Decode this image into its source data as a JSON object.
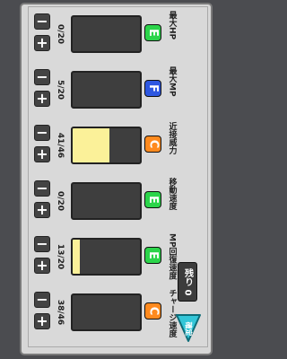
{
  "points": {
    "label": "残り 0"
  },
  "confirm": {
    "label": "確定"
  },
  "colors": {
    "E": "#2bd44a",
    "F": "#2d57e0",
    "C": "#ff8a1e",
    "bar_fill": "#fbf199"
  },
  "stats": [
    {
      "name": "最大HP",
      "count": "0/20",
      "fill": 0.0,
      "grade": "E"
    },
    {
      "name": "最大MP",
      "count": "5/20",
      "fill": 0.0,
      "grade": "F"
    },
    {
      "name": "近接威力",
      "count": "41/46",
      "fill": 0.55,
      "grade": "C"
    },
    {
      "name": "移動速度",
      "count": "0/20",
      "fill": 0.0,
      "grade": "E"
    },
    {
      "name": "MP回復速度",
      "count": "13/20",
      "fill": 0.1,
      "grade": "E"
    },
    {
      "name": "チャージ速度",
      "count": "38/46",
      "fill": 0.0,
      "grade": "C"
    }
  ]
}
